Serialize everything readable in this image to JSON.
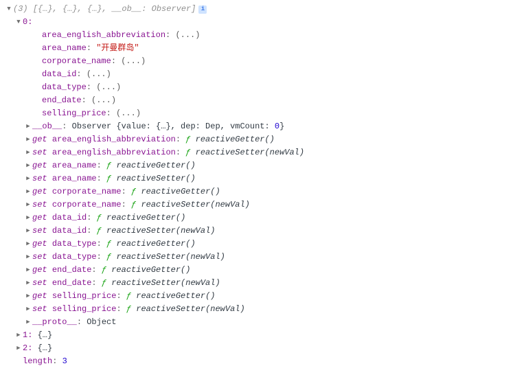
{
  "summary": {
    "count": "(3)",
    "preview": "[{…}, {…}, {…}, __ob__: Observer]"
  },
  "idx0": {
    "label": "0:",
    "props": {
      "area_english_abbreviation": {
        "key": "area_english_abbreviation",
        "val": "(...)"
      },
      "area_name": {
        "key": "area_name",
        "val": "\"开曼群岛\""
      },
      "corporate_name": {
        "key": "corporate_name",
        "val": "(...)"
      },
      "data_id": {
        "key": "data_id",
        "val": "(...)"
      },
      "data_type": {
        "key": "data_type",
        "val": "(...)"
      },
      "end_date": {
        "key": "end_date",
        "val": "(...)"
      },
      "selling_price": {
        "key": "selling_price",
        "val": "(...)"
      }
    },
    "ob": {
      "key": "__ob__",
      "prefix": "Observer {value: {…}, dep: Dep, vmCount: ",
      "vmCount": "0",
      "suffix": "}"
    },
    "accessors": [
      {
        "kw": "get",
        "name": "area_english_abbreviation",
        "sig": "reactiveGetter()"
      },
      {
        "kw": "set",
        "name": "area_english_abbreviation",
        "sig": "reactiveSetter(newVal)"
      },
      {
        "kw": "get",
        "name": "area_name",
        "sig": "reactiveGetter()"
      },
      {
        "kw": "set",
        "name": "area_name",
        "sig": "reactiveSetter()"
      },
      {
        "kw": "get",
        "name": "corporate_name",
        "sig": "reactiveGetter()"
      },
      {
        "kw": "set",
        "name": "corporate_name",
        "sig": "reactiveSetter(newVal)"
      },
      {
        "kw": "get",
        "name": "data_id",
        "sig": "reactiveGetter()"
      },
      {
        "kw": "set",
        "name": "data_id",
        "sig": "reactiveSetter(newVal)"
      },
      {
        "kw": "get",
        "name": "data_type",
        "sig": "reactiveGetter()"
      },
      {
        "kw": "set",
        "name": "data_type",
        "sig": "reactiveSetter(newVal)"
      },
      {
        "kw": "get",
        "name": "end_date",
        "sig": "reactiveGetter()"
      },
      {
        "kw": "set",
        "name": "end_date",
        "sig": "reactiveSetter(newVal)"
      },
      {
        "kw": "get",
        "name": "selling_price",
        "sig": "reactiveGetter()"
      },
      {
        "kw": "set",
        "name": "selling_price",
        "sig": "reactiveSetter(newVal)"
      }
    ],
    "proto": {
      "key": "__proto__",
      "val": "Object"
    }
  },
  "idx1": {
    "label": "1:",
    "val": "{…}"
  },
  "idx2": {
    "label": "2:",
    "val": "{…}"
  },
  "length": {
    "key": "length",
    "val": "3"
  },
  "glyphs": {
    "f": "ƒ",
    "info": "i"
  }
}
